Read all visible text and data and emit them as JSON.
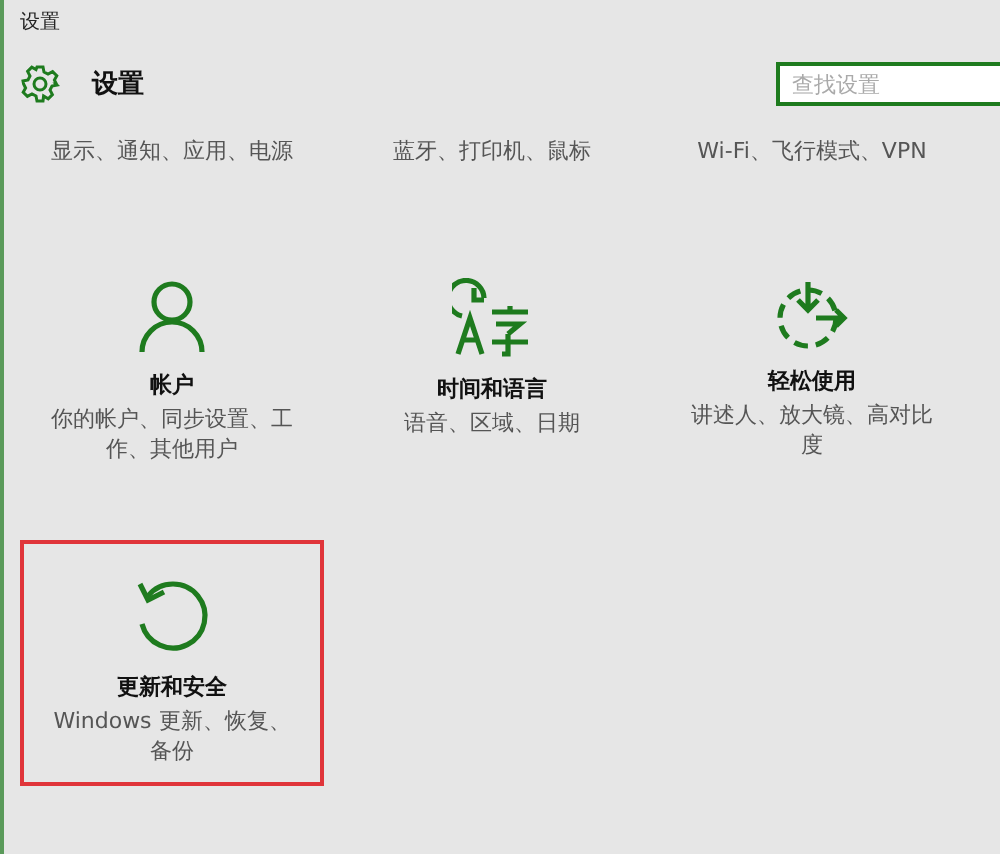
{
  "window": {
    "title": "设置"
  },
  "header": {
    "title": "设置",
    "search": {
      "placeholder": "查找设置",
      "focused": true
    }
  },
  "rows": [
    [
      {
        "kind": "none",
        "description": "显示、通知、应用、电源",
        "highlighted": false
      },
      {
        "kind": "none",
        "description": "蓝牙、打印机、鼠标",
        "highlighted": false
      },
      {
        "kind": "none",
        "description": "Wi-Fi、飞行模式、VPN",
        "highlighted": false
      }
    ],
    [
      {
        "kind": "person",
        "title": "帐户",
        "description": "你的帐户、同步设置、工作、其他用户",
        "highlighted": false
      },
      {
        "kind": "clock-language",
        "title": "时间和语言",
        "description": "语音、区域、日期",
        "highlighted": false
      },
      {
        "kind": "ease",
        "title": "轻松使用",
        "description": "讲述人、放大镜、高对比度",
        "highlighted": false
      }
    ],
    [
      {
        "kind": "refresh",
        "title": "更新和安全",
        "description": "Windows 更新、恢复、备份",
        "highlighted": true
      }
    ]
  ]
}
